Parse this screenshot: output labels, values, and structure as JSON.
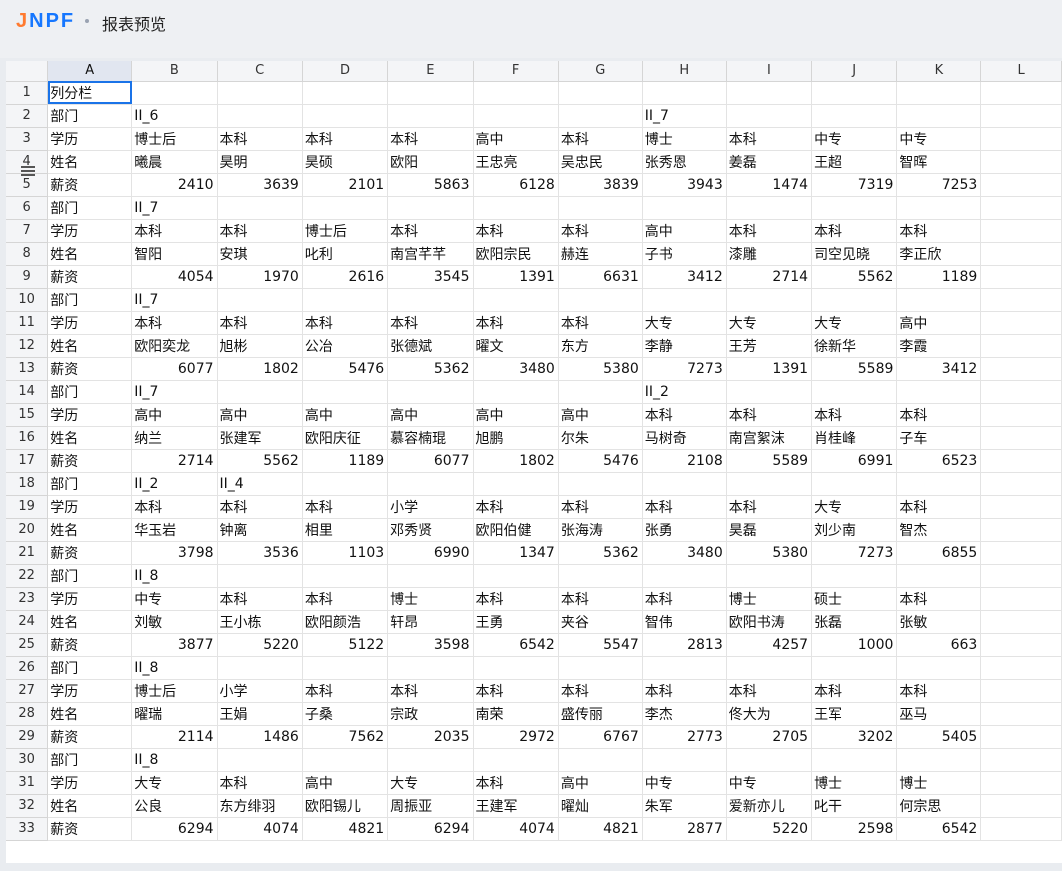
{
  "app": {
    "logo": "JNPF",
    "title": "报表预览"
  },
  "columns": [
    "A",
    "B",
    "C",
    "D",
    "E",
    "F",
    "G",
    "H",
    "I",
    "J",
    "K",
    "L"
  ],
  "rows": [
    [
      "列分栏",
      "",
      "",
      "",
      "",
      "",
      "",
      "",
      "",
      "",
      ""
    ],
    [
      "部门",
      "II_6",
      "",
      "",
      "",
      "",
      "",
      "II_7",
      "",
      "",
      ""
    ],
    [
      "学历",
      "博士后",
      "本科",
      "本科",
      "本科",
      "高中",
      "本科",
      "博士",
      "本科",
      "中专",
      "中专"
    ],
    [
      "姓名",
      "曦晨",
      "昊明",
      "昊硕",
      "欧阳",
      "王忠亮",
      "吴忠民",
      "张秀恩",
      "姜磊",
      "王超",
      "智晖"
    ],
    [
      "薪资",
      "2410",
      "3639",
      "2101",
      "5863",
      "6128",
      "3839",
      "3943",
      "1474",
      "7319",
      "7253"
    ],
    [
      "部门",
      "II_7",
      "",
      "",
      "",
      "",
      "",
      "",
      "",
      "",
      ""
    ],
    [
      "学历",
      "本科",
      "本科",
      "博士后",
      "本科",
      "本科",
      "本科",
      "高中",
      "本科",
      "本科",
      "本科"
    ],
    [
      "姓名",
      "智阳",
      "安琪",
      "叱利",
      "南宫芊芊",
      "欧阳宗民",
      "赫连",
      "子书",
      "漆雕",
      "司空见晓",
      "李正欣"
    ],
    [
      "薪资",
      "4054",
      "1970",
      "2616",
      "3545",
      "1391",
      "6631",
      "3412",
      "2714",
      "5562",
      "1189"
    ],
    [
      "部门",
      "II_7",
      "",
      "",
      "",
      "",
      "",
      "",
      "",
      "",
      ""
    ],
    [
      "学历",
      "本科",
      "本科",
      "本科",
      "本科",
      "本科",
      "本科",
      "大专",
      "大专",
      "大专",
      "高中"
    ],
    [
      "姓名",
      "欧阳奕龙",
      "旭彬",
      "公冶",
      "张德斌",
      "曜文",
      "东方",
      "李静",
      "王芳",
      "徐新华",
      "李霞"
    ],
    [
      "薪资",
      "6077",
      "1802",
      "5476",
      "5362",
      "3480",
      "5380",
      "7273",
      "1391",
      "5589",
      "3412"
    ],
    [
      "部门",
      "II_7",
      "",
      "",
      "",
      "",
      "",
      "II_2",
      "",
      "",
      ""
    ],
    [
      "学历",
      "高中",
      "高中",
      "高中",
      "高中",
      "高中",
      "高中",
      "本科",
      "本科",
      "本科",
      "本科"
    ],
    [
      "姓名",
      "纳兰",
      "张建军",
      "欧阳庆征",
      "慕容楠琨",
      "旭鹏",
      "尔朱",
      "马树奇",
      "南宫絮沫",
      "肖桂峰",
      "子车"
    ],
    [
      "薪资",
      "2714",
      "5562",
      "1189",
      "6077",
      "1802",
      "5476",
      "2108",
      "5589",
      "6991",
      "6523"
    ],
    [
      "部门",
      "II_2",
      "II_4",
      "",
      "",
      "",
      "",
      "",
      "",
      "",
      ""
    ],
    [
      "学历",
      "本科",
      "本科",
      "本科",
      "小学",
      "本科",
      "本科",
      "本科",
      "本科",
      "大专",
      "本科"
    ],
    [
      "姓名",
      "华玉岩",
      "钟离",
      "相里",
      "邓秀贤",
      "欧阳伯健",
      "张海涛",
      "张勇",
      "昊磊",
      "刘少南",
      "智杰"
    ],
    [
      "薪资",
      "3798",
      "3536",
      "1103",
      "6990",
      "1347",
      "5362",
      "3480",
      "5380",
      "7273",
      "6855"
    ],
    [
      "部门",
      "II_8",
      "",
      "",
      "",
      "",
      "",
      "",
      "",
      "",
      ""
    ],
    [
      "学历",
      "中专",
      "本科",
      "本科",
      "博士",
      "本科",
      "本科",
      "本科",
      "博士",
      "硕士",
      "本科"
    ],
    [
      "姓名",
      "刘敏",
      "王小栋",
      "欧阳颜浩",
      "轩昂",
      "王勇",
      "夹谷",
      "智伟",
      "欧阳书涛",
      "张磊",
      "张敏"
    ],
    [
      "薪资",
      "3877",
      "5220",
      "5122",
      "3598",
      "6542",
      "5547",
      "2813",
      "4257",
      "1000",
      "663"
    ],
    [
      "部门",
      "II_8",
      "",
      "",
      "",
      "",
      "",
      "",
      "",
      "",
      ""
    ],
    [
      "学历",
      "博士后",
      "小学",
      "本科",
      "本科",
      "本科",
      "本科",
      "本科",
      "本科",
      "本科",
      "本科"
    ],
    [
      "姓名",
      "曜瑞",
      "王娟",
      "子桑",
      "宗政",
      "南荣",
      "盛传丽",
      "李杰",
      "佟大为",
      "王军",
      "巫马"
    ],
    [
      "薪资",
      "2114",
      "1486",
      "7562",
      "2035",
      "2972",
      "6767",
      "2773",
      "2705",
      "3202",
      "5405"
    ],
    [
      "部门",
      "II_8",
      "",
      "",
      "",
      "",
      "",
      "",
      "",
      "",
      ""
    ],
    [
      "学历",
      "大专",
      "本科",
      "高中",
      "大专",
      "本科",
      "高中",
      "中专",
      "中专",
      "博士",
      "博士"
    ],
    [
      "姓名",
      "公良",
      "东方绯羽",
      "欧阳锡儿",
      "周振亚",
      "王建军",
      "曜灿",
      "朱军",
      "爱新亦儿",
      "叱干",
      "何宗思"
    ],
    [
      "薪资",
      "6294",
      "4074",
      "4821",
      "6294",
      "4074",
      "4821",
      "2877",
      "5220",
      "2598",
      "6542"
    ]
  ]
}
